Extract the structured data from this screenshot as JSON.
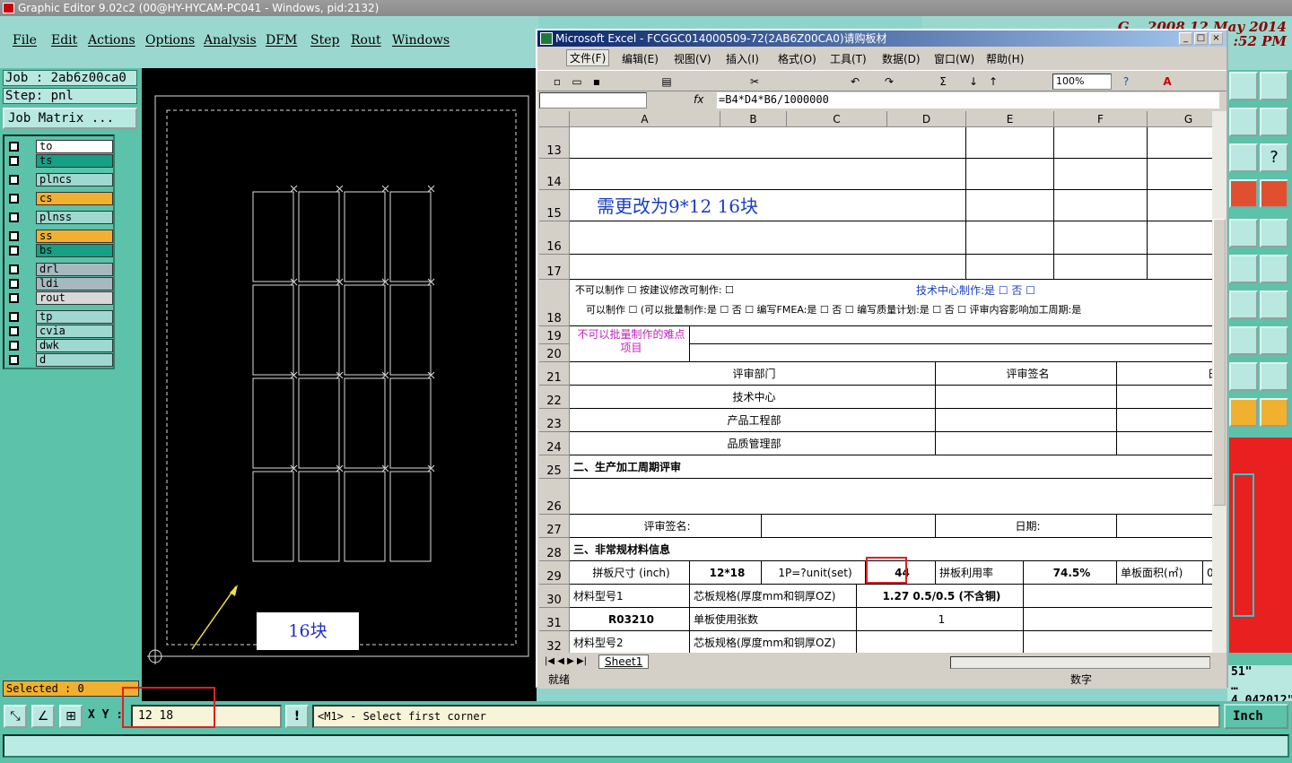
{
  "app": {
    "title": "Graphic Editor 9.02c2 (00@HY-HYCAM-PC041 - Windows, pid:2132)"
  },
  "menu": [
    "File",
    "Edit",
    "Actions",
    "Options",
    "Analysis",
    "DFM",
    "Step",
    "Rout",
    "Windows"
  ],
  "clock": {
    "line1": "G… 2008 12 May 2014",
    "line2": ":52 PM"
  },
  "job": {
    "job": "Job : 2ab6z00ca0",
    "step": "Step: pnl",
    "matrix": "Job Matrix ..."
  },
  "layers": [
    {
      "name": "to",
      "color": "#ffffff"
    },
    {
      "name": "ts",
      "color": "#16a085"
    },
    {
      "name": "plncs",
      "color": "#9fd8d0"
    },
    {
      "name": "cs",
      "color": "#f0b030"
    },
    {
      "name": "plnss",
      "color": "#9fd8d0"
    },
    {
      "name": "ss",
      "color": "#f0b030"
    },
    {
      "name": "bs",
      "color": "#16a085"
    },
    {
      "name": "drl",
      "color": "#a8b8c0"
    },
    {
      "name": "ldi",
      "color": "#a8b8c0"
    },
    {
      "name": "rout",
      "color": "#d8d8d8"
    },
    {
      "name": "tp",
      "color": "#9fd8d0"
    },
    {
      "name": "cvia",
      "color": "#9fd8d0"
    },
    {
      "name": "dwk",
      "color": "#9fd8d0"
    },
    {
      "name": "d",
      "color": "#9fd8d0"
    }
  ],
  "selected": "Selected : 0",
  "canvas": {
    "annotation": "16块"
  },
  "bottom": {
    "xy_label": "X Y :",
    "xy_value": "12  18",
    "prompt": "<M1> - Select first corner",
    "unit": "Inch"
  },
  "right": {
    "text1": "51\"",
    "text2": "… 4.042012\""
  },
  "excel": {
    "title": "Microsoft Excel - FCGGC014000509-72(2AB6Z00CA0)请购板材",
    "menu": [
      "文件(F)",
      "编辑(E)",
      "视图(V)",
      "插入(I)",
      "格式(O)",
      "工具(T)",
      "数据(D)",
      "窗口(W)",
      "帮助(H)"
    ],
    "zoom": "100%",
    "fx": "fx",
    "formula": "=B4*D4*B6/1000000",
    "columns": [
      "A",
      "B",
      "C",
      "D",
      "E",
      "F",
      "G"
    ],
    "rows": [
      "13",
      "14",
      "15",
      "16",
      "17",
      "18",
      "19",
      "20",
      "21",
      "22",
      "23",
      "24",
      "25",
      "26",
      "27",
      "28",
      "29",
      "30",
      "31",
      "32"
    ],
    "note": "需更改为9*12  16块",
    "r18a": "不可以制作 ☐   按建议修改可制作: ☐",
    "r18b": "技术中心制作:是 ☐  否 ☐",
    "r18c": "可以制作 ☐  (可以批量制作:是 ☐  否 ☐   编写FMEA:是 ☐  否 ☐   编写质量计划:是 ☐   否 ☐   评审内容影响加工周期:是",
    "r19": "不可以批量制作的难点项目",
    "r21": [
      "评审部门",
      "评审签名",
      "日期"
    ],
    "depts": [
      "技术中心",
      "产品工程部",
      "品质管理部"
    ],
    "s2": "二、生产加工周期评审",
    "r27": [
      "评审签名:",
      "日期:"
    ],
    "s3": "三、非常规材料信息",
    "r29": [
      "拼板尺寸 (inch)",
      "12*18",
      "1P=?unit(set)",
      "44",
      "拼板利用率",
      "74.5%",
      "单板面积(㎡)",
      "0"
    ],
    "r30": [
      "材料型号1",
      "芯板规格(厚度mm和铜厚OZ)",
      "1.27 0.5/0.5 (不含铜)"
    ],
    "r31": [
      "R03210",
      "单板使用张数",
      "1"
    ],
    "r32": [
      "材料型号2",
      "芯板规格(厚度mm和铜厚OZ)"
    ],
    "sheet": "Sheet1",
    "status": "就绪",
    "status2": "数字"
  }
}
